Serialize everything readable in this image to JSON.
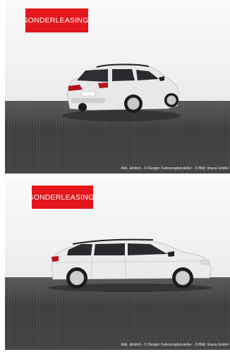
{
  "images": [
    {
      "badge": "SONDERLEASING.",
      "caption": "Abb. ähnlich - © Design: Fahrzeughersteller - © Bild: Imaca GmbH",
      "view": "rear-three-quarter"
    },
    {
      "badge": "SONDERLEASING.",
      "caption": "Abb. ähnlich - © Design: Fahrzeughersteller - © Bild: Imaca GmbH",
      "view": "side"
    }
  ],
  "colors": {
    "badge": "#e4161c",
    "car_body": "#e9e9e9",
    "floor": "#4a4a4a"
  }
}
